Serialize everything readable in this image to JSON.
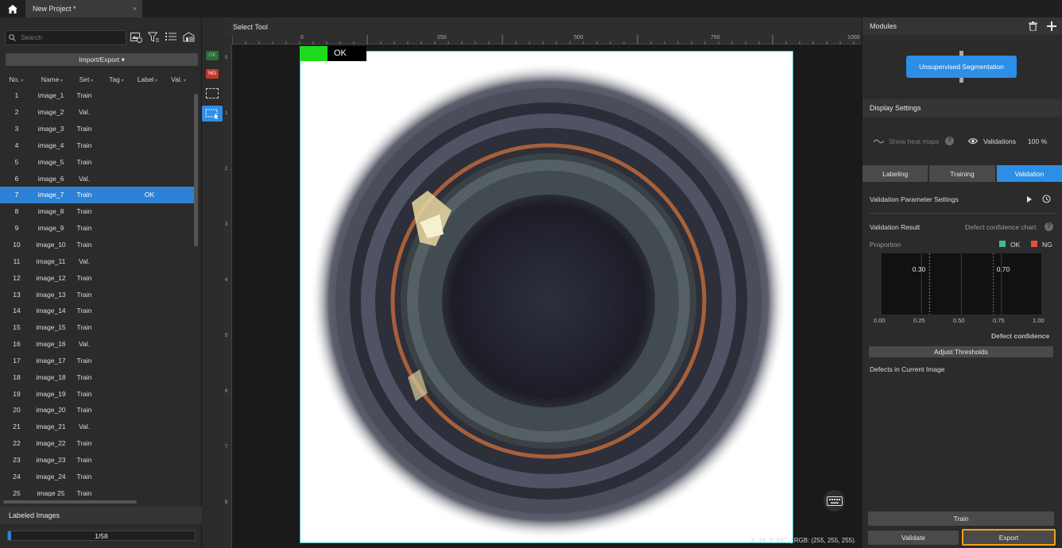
{
  "titlebar": {
    "tab_title": "New Project *",
    "close_glyph": "×"
  },
  "left_panel": {
    "search_placeholder": "Search",
    "import_export_label": "Import/Export",
    "columns": [
      "No.",
      "Name",
      "Set",
      "Tag",
      "Label",
      "Val."
    ],
    "rows": [
      {
        "no": "1",
        "name": "image_1",
        "set": "Train",
        "label": ""
      },
      {
        "no": "2",
        "name": "image_2",
        "set": "Val.",
        "label": ""
      },
      {
        "no": "3",
        "name": "image_3",
        "set": "Train",
        "label": ""
      },
      {
        "no": "4",
        "name": "image_4",
        "set": "Train",
        "label": ""
      },
      {
        "no": "5",
        "name": "image_5",
        "set": "Train",
        "label": ""
      },
      {
        "no": "6",
        "name": "image_6",
        "set": "Val.",
        "label": ""
      },
      {
        "no": "7",
        "name": "image_7",
        "set": "Train",
        "label": "OK"
      },
      {
        "no": "8",
        "name": "image_8",
        "set": "Train",
        "label": ""
      },
      {
        "no": "9",
        "name": "image_9",
        "set": "Train",
        "label": ""
      },
      {
        "no": "10",
        "name": "image_10",
        "set": "Train",
        "label": ""
      },
      {
        "no": "11",
        "name": "image_11",
        "set": "Val.",
        "label": ""
      },
      {
        "no": "12",
        "name": "image_12",
        "set": "Train",
        "label": ""
      },
      {
        "no": "13",
        "name": "image_13",
        "set": "Train",
        "label": ""
      },
      {
        "no": "14",
        "name": "image_14",
        "set": "Train",
        "label": ""
      },
      {
        "no": "15",
        "name": "image_15",
        "set": "Train",
        "label": ""
      },
      {
        "no": "16",
        "name": "image_16",
        "set": "Val.",
        "label": ""
      },
      {
        "no": "17",
        "name": "image_17",
        "set": "Train",
        "label": ""
      },
      {
        "no": "18",
        "name": "image_18",
        "set": "Train",
        "label": ""
      },
      {
        "no": "19",
        "name": "image_19",
        "set": "Train",
        "label": ""
      },
      {
        "no": "20",
        "name": "image_20",
        "set": "Train",
        "label": ""
      },
      {
        "no": "21",
        "name": "image_21",
        "set": "Val.",
        "label": ""
      },
      {
        "no": "22",
        "name": "image_22",
        "set": "Train",
        "label": ""
      },
      {
        "no": "23",
        "name": "image_23",
        "set": "Train",
        "label": ""
      },
      {
        "no": "24",
        "name": "image_24",
        "set": "Train",
        "label": ""
      },
      {
        "no": "25",
        "name": "image 25",
        "set": "Train",
        "label": ""
      }
    ],
    "selected_row": 7,
    "labeled_images_title": "Labeled Images",
    "labeled_progress_text": "1/58",
    "labeled_progress_fraction": 0.017
  },
  "tool_strip": {
    "ok_tag": "OK",
    "ng_tag": "NG"
  },
  "canvas": {
    "header_title": "Select Tool",
    "ruler_h_labels": [
      "0",
      "250",
      "500",
      "750",
      "1000"
    ],
    "ruler_v_labels": [
      "0",
      "1",
      "2",
      "3",
      "4",
      "5",
      "6",
      "7",
      "8"
    ],
    "image_label": "OK",
    "ok_color": "#1ddb1d",
    "coordinate_readout": "X: 18, Y: 637, | RGB: (255, 255, 255)."
  },
  "right_panel": {
    "modules_title": "Modules",
    "module_name": "Unsupervised Segmentation",
    "display_settings_title": "Display Settings",
    "show_heat_maps_label": "Show heat maps",
    "validations_label": "Validations",
    "validations_value": "100",
    "validations_unit": "%",
    "tabs": [
      "Labeling",
      "Training",
      "Validation"
    ],
    "active_tab": "Validation",
    "validation_param_label": "Validation Parameter Settings",
    "validation_result_label": "Validation Result",
    "defect_chart_label": "Defect confidence chart",
    "proportion_label": "Proportion",
    "legend_ok": "OK",
    "legend_ng": "NG",
    "ok_color": "#3cc08a",
    "ng_color": "#e0503a",
    "adjust_thresholds_label": "Adjust Thresholds",
    "defects_current_label": "Defects in Current Image",
    "train_label": "Train",
    "validate_label": "Validate",
    "export_label": "Export",
    "accent_color": "#2d8ee6",
    "highlight_color": "#f0a020"
  },
  "chart_data": {
    "type": "line",
    "title": "",
    "xlabel": "Defect confidence",
    "ylabel": "",
    "xlim": [
      0,
      1
    ],
    "x_ticks": [
      "0.00",
      "0.25",
      "0.50",
      "0.75",
      "1.00"
    ],
    "thresholds": [
      {
        "value": 0.3,
        "label": "0.30"
      },
      {
        "value": 0.7,
        "label": "0.70"
      }
    ],
    "series": []
  }
}
